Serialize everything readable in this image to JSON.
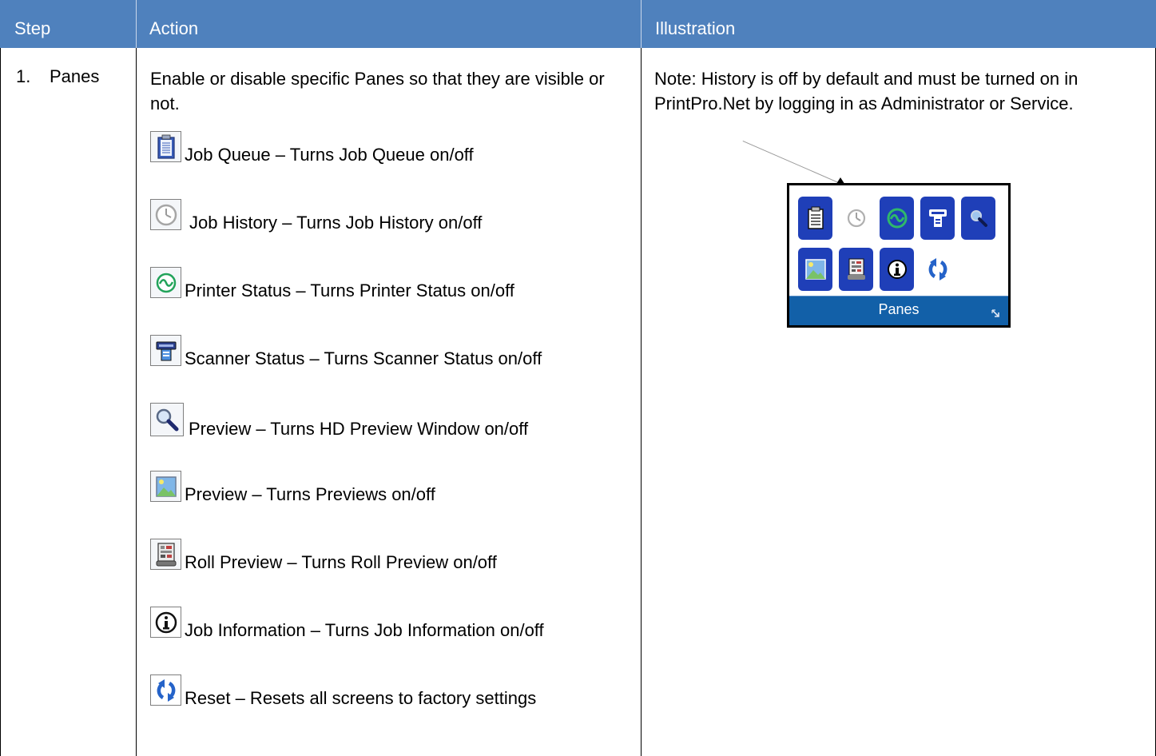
{
  "table": {
    "headers": {
      "step": "Step",
      "action": "Action",
      "illustration": "Illustration"
    },
    "row": {
      "step_number": "1.",
      "step_name": "Panes",
      "action_intro": "Enable or disable specific Panes so that they are visible or not.",
      "items": [
        {
          "icon": "clipboard-icon",
          "text": "Job Queue – Turns Job Queue on/off"
        },
        {
          "icon": "clock-icon",
          "text": "Job History – Turns Job History on/off"
        },
        {
          "icon": "printer-status-icon",
          "text": "Printer Status – Turns Printer Status on/off"
        },
        {
          "icon": "scanner-icon",
          "text": "Scanner Status – Turns Scanner Status on/off"
        },
        {
          "icon": "magnifier-icon",
          "text": "Preview – Turns HD Preview Window on/off"
        },
        {
          "icon": "image-icon",
          "text": "Preview – Turns Previews on/off"
        },
        {
          "icon": "roll-preview-icon",
          "text": "Roll Preview – Turns Roll Preview on/off"
        },
        {
          "icon": "info-icon",
          "text": "Job Information – Turns Job Information on/off"
        },
        {
          "icon": "reset-icon",
          "text": "Reset – Resets all screens to factory settings"
        }
      ],
      "illustration_note": "Note: History is off by default and must be turned on in PrintPro.Net by logging in as Administrator or Service.",
      "ribbon": {
        "label": "Panes"
      }
    }
  },
  "colors": {
    "header_bg": "#4f81bd",
    "ribbon_button": "#1f3fb8",
    "ribbon_footer": "#1260a8"
  }
}
